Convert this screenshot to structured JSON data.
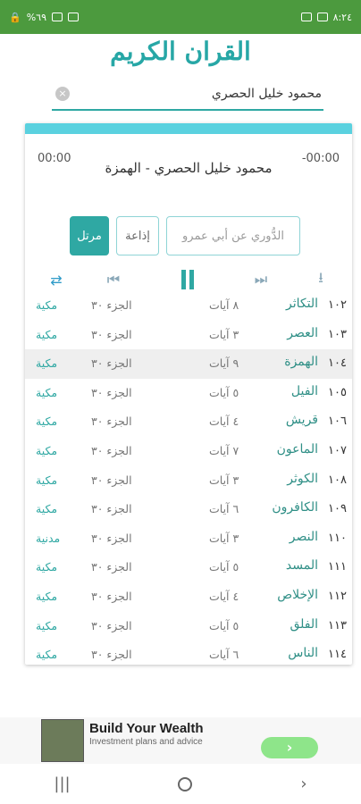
{
  "status_bar": {
    "time": "٨:٢٤",
    "battery": "%٦٩",
    "icons": [
      "lock-icon",
      "wifi-icon",
      "signal-icon",
      "gallery-icon",
      "whatsapp-icon"
    ]
  },
  "app_title": "القران الكريم",
  "search": {
    "value": "محمود خليل الحصري",
    "clear_icon": "×"
  },
  "player": {
    "elapsed": "00:00",
    "remaining": "-00:00",
    "now_playing": "محمود خليل الحصري - الهمزة",
    "chips": [
      {
        "label": "مرتل",
        "active": true
      },
      {
        "label": "إذاعة",
        "active": false
      },
      {
        "label": "الدُّوري عن أبي عمرو",
        "active": false
      }
    ],
    "controls": {
      "repeat_icon": "⇄",
      "prev_icon": "⏮",
      "next_icon": "⏭",
      "download_icon": "⭳"
    }
  },
  "surah_list": [
    {
      "num": "١٠٢",
      "name": "التكاثر",
      "ayat": "٨ آيات",
      "juz": "الجزء ٣٠",
      "type": "مكية"
    },
    {
      "num": "١٠٣",
      "name": "العصر",
      "ayat": "٣ آيات",
      "juz": "الجزء ٣٠",
      "type": "مكية"
    },
    {
      "num": "١٠٤",
      "name": "الهمزة",
      "ayat": "٩ آيات",
      "juz": "الجزء ٣٠",
      "type": "مكية"
    },
    {
      "num": "١٠٥",
      "name": "الفيل",
      "ayat": "٥ آيات",
      "juz": "الجزء ٣٠",
      "type": "مكية"
    },
    {
      "num": "١٠٦",
      "name": "قريش",
      "ayat": "٤ آيات",
      "juz": "الجزء ٣٠",
      "type": "مكية"
    },
    {
      "num": "١٠٧",
      "name": "الماعون",
      "ayat": "٧ آيات",
      "juz": "الجزء ٣٠",
      "type": "مكية"
    },
    {
      "num": "١٠٨",
      "name": "الكوثر",
      "ayat": "٣ آيات",
      "juz": "الجزء ٣٠",
      "type": "مكية"
    },
    {
      "num": "١٠٩",
      "name": "الكافرون",
      "ayat": "٦ آيات",
      "juz": "الجزء ٣٠",
      "type": "مكية"
    },
    {
      "num": "١١٠",
      "name": "النصر",
      "ayat": "٣ آيات",
      "juz": "الجزء ٣٠",
      "type": "مدنية"
    },
    {
      "num": "١١١",
      "name": "المسد",
      "ayat": "٥ آيات",
      "juz": "الجزء ٣٠",
      "type": "مكية"
    },
    {
      "num": "١١٢",
      "name": "الإخلاص",
      "ayat": "٤ آيات",
      "juz": "الجزء ٣٠",
      "type": "مكية"
    },
    {
      "num": "١١٣",
      "name": "الفلق",
      "ayat": "٥ آيات",
      "juz": "الجزء ٣٠",
      "type": "مكية"
    },
    {
      "num": "١١٤",
      "name": "الناس",
      "ayat": "٦ آيات",
      "juz": "الجزء ٣٠",
      "type": "مكية"
    }
  ],
  "ad": {
    "title": "Build Your Wealth",
    "subtitle": "Investment plans and advice",
    "button_icon": "›"
  },
  "nav": {
    "recents_icon": "|||",
    "back_icon": "›"
  },
  "colors": {
    "accent": "#2fa8a3",
    "status_bar": "#4c9a3e",
    "top_strip": "#5ad1df"
  }
}
